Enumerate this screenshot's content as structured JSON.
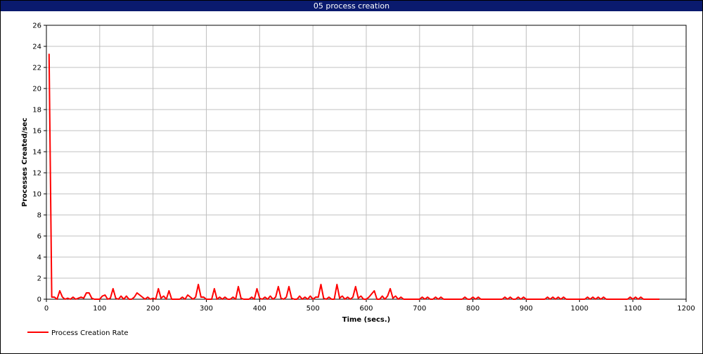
{
  "window": {
    "title": "05 process creation"
  },
  "chart_data": {
    "type": "line",
    "title": "05 process creation",
    "xlabel": "Time (secs.)",
    "ylabel": "Processes Created/sec",
    "xlim": [
      0,
      1200
    ],
    "ylim": [
      0,
      26
    ],
    "xticks": [
      0,
      100,
      200,
      300,
      400,
      500,
      600,
      700,
      800,
      900,
      1000,
      1100,
      1200
    ],
    "yticks": [
      0,
      2,
      4,
      6,
      8,
      10,
      12,
      14,
      16,
      18,
      20,
      22,
      24,
      26
    ],
    "grid": true,
    "legend_position": "bottom-left",
    "series": [
      {
        "name": "Process Creation Rate",
        "color": "#ff0000",
        "points": [
          [
            5,
            23.3
          ],
          [
            10,
            0.2
          ],
          [
            15,
            0.2
          ],
          [
            20,
            0
          ],
          [
            25,
            0.8
          ],
          [
            30,
            0.2
          ],
          [
            35,
            0
          ],
          [
            40,
            0.1
          ],
          [
            45,
            0
          ],
          [
            50,
            0.2
          ],
          [
            55,
            0
          ],
          [
            60,
            0.1
          ],
          [
            65,
            0.2
          ],
          [
            70,
            0.1
          ],
          [
            75,
            0.6
          ],
          [
            80,
            0.6
          ],
          [
            85,
            0.1
          ],
          [
            90,
            0
          ],
          [
            100,
            0
          ],
          [
            105,
            0.3
          ],
          [
            110,
            0.4
          ],
          [
            115,
            0
          ],
          [
            120,
            0.1
          ],
          [
            125,
            1.0
          ],
          [
            130,
            0.1
          ],
          [
            135,
            0
          ],
          [
            140,
            0.3
          ],
          [
            145,
            0
          ],
          [
            150,
            0.3
          ],
          [
            155,
            0
          ],
          [
            160,
            0
          ],
          [
            165,
            0.2
          ],
          [
            170,
            0.6
          ],
          [
            175,
            0.4
          ],
          [
            180,
            0.2
          ],
          [
            185,
            0
          ],
          [
            190,
            0.2
          ],
          [
            195,
            0
          ],
          [
            200,
            0.1
          ],
          [
            205,
            0
          ],
          [
            210,
            1.0
          ],
          [
            215,
            0.1
          ],
          [
            220,
            0.3
          ],
          [
            225,
            0
          ],
          [
            230,
            0.8
          ],
          [
            235,
            0
          ],
          [
            240,
            0
          ],
          [
            250,
            0
          ],
          [
            255,
            0.2
          ],
          [
            260,
            0
          ],
          [
            265,
            0.4
          ],
          [
            270,
            0.2
          ],
          [
            275,
            0
          ],
          [
            280,
            0.2
          ],
          [
            285,
            1.4
          ],
          [
            290,
            0.2
          ],
          [
            295,
            0.2
          ],
          [
            300,
            0
          ],
          [
            310,
            0
          ],
          [
            315,
            1.0
          ],
          [
            320,
            0
          ],
          [
            325,
            0.2
          ],
          [
            330,
            0
          ],
          [
            335,
            0.2
          ],
          [
            340,
            0
          ],
          [
            345,
            0
          ],
          [
            350,
            0.2
          ],
          [
            355,
            0
          ],
          [
            360,
            1.2
          ],
          [
            365,
            0.1
          ],
          [
            370,
            0
          ],
          [
            380,
            0
          ],
          [
            385,
            0.2
          ],
          [
            390,
            0
          ],
          [
            395,
            1.0
          ],
          [
            400,
            0.1
          ],
          [
            405,
            0
          ],
          [
            410,
            0.2
          ],
          [
            415,
            0
          ],
          [
            420,
            0.3
          ],
          [
            425,
            0
          ],
          [
            430,
            0.2
          ],
          [
            435,
            1.2
          ],
          [
            440,
            0.1
          ],
          [
            445,
            0
          ],
          [
            450,
            0.2
          ],
          [
            455,
            1.2
          ],
          [
            460,
            0.1
          ],
          [
            465,
            0
          ],
          [
            470,
            0
          ],
          [
            475,
            0.3
          ],
          [
            480,
            0
          ],
          [
            485,
            0.2
          ],
          [
            490,
            0
          ],
          [
            495,
            0.3
          ],
          [
            500,
            0
          ],
          [
            505,
            0.2
          ],
          [
            510,
            0.2
          ],
          [
            515,
            1.4
          ],
          [
            520,
            0.1
          ],
          [
            525,
            0
          ],
          [
            530,
            0.2
          ],
          [
            535,
            0
          ],
          [
            540,
            0
          ],
          [
            545,
            1.4
          ],
          [
            550,
            0.1
          ],
          [
            555,
            0.3
          ],
          [
            560,
            0
          ],
          [
            565,
            0.2
          ],
          [
            570,
            0
          ],
          [
            575,
            0.2
          ],
          [
            580,
            1.2
          ],
          [
            585,
            0.1
          ],
          [
            590,
            0.3
          ],
          [
            595,
            0
          ],
          [
            600,
            0
          ],
          [
            605,
            0.2
          ],
          [
            610,
            0.5
          ],
          [
            615,
            0.8
          ],
          [
            620,
            0
          ],
          [
            625,
            0
          ],
          [
            630,
            0.3
          ],
          [
            635,
            0
          ],
          [
            640,
            0.3
          ],
          [
            645,
            1.0
          ],
          [
            650,
            0.1
          ],
          [
            655,
            0.3
          ],
          [
            660,
            0
          ],
          [
            665,
            0.2
          ],
          [
            670,
            0
          ],
          [
            700,
            0
          ],
          [
            705,
            0.2
          ],
          [
            710,
            0
          ],
          [
            715,
            0.2
          ],
          [
            720,
            0
          ],
          [
            725,
            0
          ],
          [
            730,
            0.2
          ],
          [
            735,
            0
          ],
          [
            740,
            0.2
          ],
          [
            745,
            0
          ],
          [
            780,
            0
          ],
          [
            785,
            0.2
          ],
          [
            790,
            0
          ],
          [
            795,
            0
          ],
          [
            800,
            0.2
          ],
          [
            805,
            0
          ],
          [
            810,
            0.2
          ],
          [
            815,
            0
          ],
          [
            855,
            0
          ],
          [
            860,
            0.2
          ],
          [
            865,
            0
          ],
          [
            870,
            0.2
          ],
          [
            875,
            0
          ],
          [
            880,
            0
          ],
          [
            885,
            0.2
          ],
          [
            890,
            0
          ],
          [
            895,
            0.2
          ],
          [
            900,
            0
          ],
          [
            935,
            0
          ],
          [
            940,
            0.2
          ],
          [
            945,
            0
          ],
          [
            950,
            0.2
          ],
          [
            955,
            0
          ],
          [
            960,
            0.2
          ],
          [
            965,
            0
          ],
          [
            970,
            0.2
          ],
          [
            975,
            0
          ],
          [
            1010,
            0
          ],
          [
            1015,
            0.2
          ],
          [
            1020,
            0
          ],
          [
            1025,
            0.2
          ],
          [
            1030,
            0
          ],
          [
            1035,
            0.2
          ],
          [
            1040,
            0
          ],
          [
            1045,
            0.2
          ],
          [
            1050,
            0
          ],
          [
            1090,
            0
          ],
          [
            1095,
            0.2
          ],
          [
            1100,
            0
          ],
          [
            1105,
            0.2
          ],
          [
            1110,
            0
          ],
          [
            1115,
            0.2
          ],
          [
            1120,
            0
          ],
          [
            1150,
            0
          ]
        ]
      }
    ]
  }
}
